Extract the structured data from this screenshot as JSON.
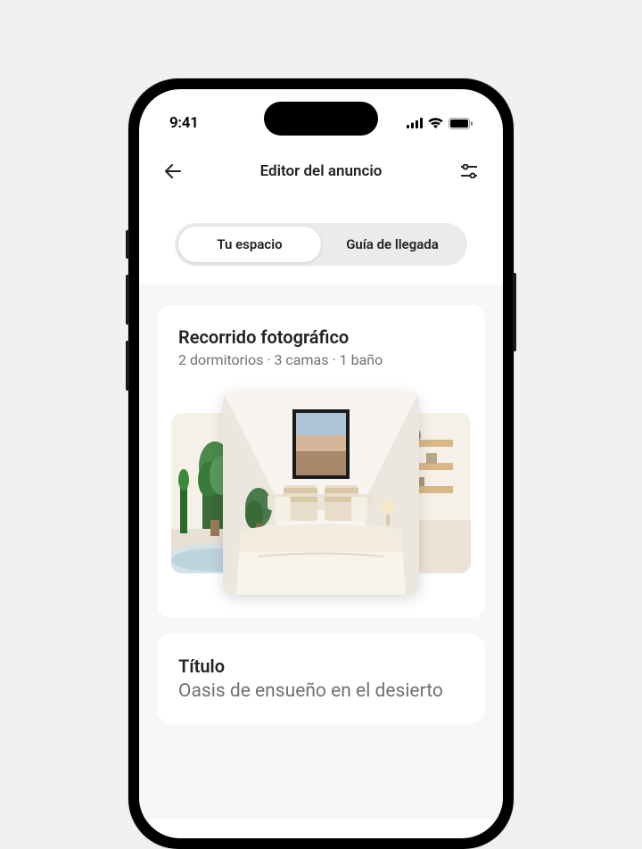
{
  "status": {
    "time": "9:41"
  },
  "header": {
    "title": "Editor del anuncio"
  },
  "tabs": {
    "tab1": "Tu espacio",
    "tab2": "Guía de llegada"
  },
  "photoTour": {
    "title": "Recorrido fotográfico",
    "subtitle": "2 dormitorios · 3 camas · 1 baño"
  },
  "titleCard": {
    "label": "Título",
    "value": "Oasis de ensueño en el desierto"
  }
}
